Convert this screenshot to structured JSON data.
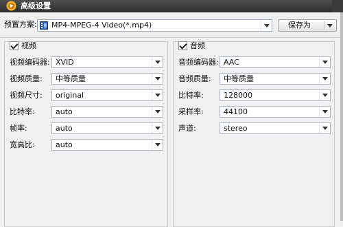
{
  "window": {
    "title": "高级设置"
  },
  "preset": {
    "label": "预置方案:",
    "value": "MP4-MPEG-4 Video(*.mp4)",
    "save_as_label": "保存为"
  },
  "video": {
    "title": "视频",
    "enabled": true,
    "rows": [
      {
        "label": "视频编码器:",
        "value": "XVID"
      },
      {
        "label": "视频质量:",
        "value": "中等质量"
      },
      {
        "label": "视频尺寸:",
        "value": "original"
      },
      {
        "label": "比特率:",
        "value": "auto"
      },
      {
        "label": "帧率:",
        "value": "auto"
      },
      {
        "label": "宽高比:",
        "value": "auto"
      }
    ]
  },
  "audio": {
    "title": "音频",
    "enabled": true,
    "rows": [
      {
        "label": "音频编码器:",
        "value": "AAC"
      },
      {
        "label": "音频质量:",
        "value": "中等质量"
      },
      {
        "label": "比特率:",
        "value": "128000"
      },
      {
        "label": "采样率:",
        "value": "44100"
      },
      {
        "label": "声道:",
        "value": "stereo"
      }
    ]
  },
  "icons": {
    "app": "app-logo-icon",
    "preset": "film-icon",
    "dropdown": "chevron-down-icon"
  },
  "colors": {
    "titlebar": "#3a3a3a",
    "select_border": "#a9b3c1",
    "app_icon": "#e8a11e"
  }
}
